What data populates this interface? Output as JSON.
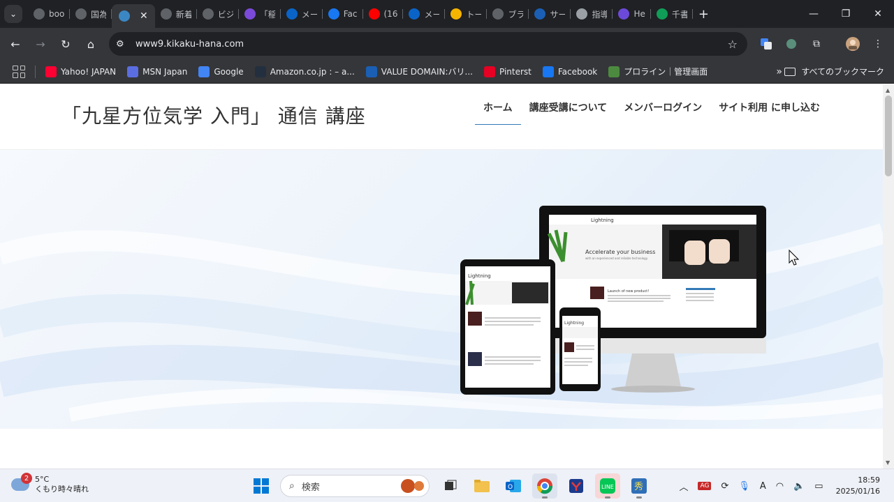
{
  "browser": {
    "tabs": [
      {
        "label": "boo",
        "icon": "globe-icon",
        "color": "#5f6368"
      },
      {
        "label": "国為",
        "icon": "globe-icon",
        "color": "#5f6368"
      },
      {
        "label": "",
        "icon": "wordpress-icon",
        "color": "#3b87c4",
        "active": true
      },
      {
        "label": "新着",
        "icon": "globe-icon",
        "color": "#5f6368"
      },
      {
        "label": "ビジ",
        "icon": "globe-icon",
        "color": "#5f6368"
      },
      {
        "label": "「稲",
        "icon": "app-icon",
        "color": "#7b4ad9"
      },
      {
        "label": "メー",
        "icon": "outlook-icon",
        "color": "#0a64c8"
      },
      {
        "label": "Fac",
        "icon": "facebook-icon",
        "color": "#1877f2"
      },
      {
        "label": "(16",
        "icon": "youtube-icon",
        "color": "#ff0000"
      },
      {
        "label": "メー",
        "icon": "outlook-icon",
        "color": "#0a64c8"
      },
      {
        "label": "トー",
        "icon": "slides-icon",
        "color": "#f4b400"
      },
      {
        "label": "ブラ",
        "icon": "globe-icon",
        "color": "#5f6368"
      },
      {
        "label": "サー",
        "icon": "valuedomain-icon",
        "color": "#1a5fb4"
      },
      {
        "label": "指導",
        "icon": "image-icon",
        "color": "#9aa0a6"
      },
      {
        "label": "He",
        "icon": "video-icon",
        "color": "#6c4ad9"
      },
      {
        "label": "千書",
        "icon": "sheets-icon",
        "color": "#0f9d58"
      }
    ],
    "close_glyph": "✕",
    "new_tab_glyph": "+",
    "url": "www9.kikaku-hana.com"
  },
  "bookmarks": [
    {
      "label": "Yahoo! JAPAN",
      "icon": "yahoo-icon",
      "color": "#ff0033"
    },
    {
      "label": "MSN Japan",
      "icon": "msn-icon",
      "color": "#5b6ee1"
    },
    {
      "label": "Google",
      "icon": "google-icon",
      "color": "#4285f4"
    },
    {
      "label": "Amazon.co.jp : – a...",
      "icon": "amazon-icon",
      "color": "#232f3e"
    },
    {
      "label": "VALUE DOMAIN:バリ...",
      "icon": "valuedomain-icon",
      "color": "#1a5fb4"
    },
    {
      "label": "Pinterst",
      "icon": "pinterest-icon",
      "color": "#e60023"
    },
    {
      "label": "Facebook",
      "icon": "facebook-icon",
      "color": "#1877f2"
    },
    {
      "label": "プロライン｜管理画面",
      "icon": "proline-icon",
      "color": "#4c8b3f"
    }
  ],
  "all_bookmarks": "すべてのブックマーク",
  "site": {
    "title": "「九星方位気学 入門」 通信 講座",
    "nav": [
      "ホーム",
      "講座受講について",
      "メンバーログイン",
      "サイト利用 に申し込む"
    ]
  },
  "mock": {
    "brand": "Lightning",
    "headline": "Accelerate your business",
    "sub": "with an experienced and reliable technology.",
    "post": "Launch of new product!"
  },
  "taskbar": {
    "badge": "2",
    "temp": "5°C",
    "weather": "くもり時々晴れ",
    "search_placeholder": "検索",
    "time": "18:59",
    "date": "2025/01/16"
  }
}
